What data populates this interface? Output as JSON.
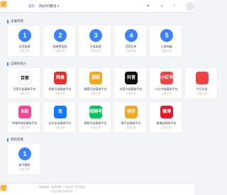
{
  "nav": {
    "logo": "鄉",
    "home": "首页",
    "map": "网站导航",
    "more": "更多 ▾",
    "icons": [
      "lightbulb-icon",
      "search-icon",
      "moon-icon"
    ]
  },
  "sections": {
    "main": {
      "title": "主编项目",
      "cards": [
        {
          "icon": "1",
          "color": "#3b82f6",
          "name": "抖音极速",
          "sub": "注册立享"
        },
        {
          "icon": "2",
          "color": "#3b82f6",
          "name": "网络赞奖励",
          "sub": "注册立享"
        },
        {
          "icon": "3",
          "color": "#3b82f6",
          "name": "头条极速",
          "sub": "注册立享"
        },
        {
          "icon": "4",
          "color": "#3b82f6",
          "name": "百家文库",
          "sub": "注册立享"
        },
        {
          "icon": "5",
          "color": "#3b82f6",
          "name": "小游戏赚",
          "sub": "注册立享"
        }
      ]
    },
    "media": {
      "title": "自媒体收入",
      "cards": [
        {
          "icon": "百家",
          "color": "#ffffff",
          "fg": "#111111",
          "name": "百家号自媒体平台",
          "sub": "注册立享"
        },
        {
          "icon": "网易",
          "color": "#e0322e",
          "fg": "#ffffff",
          "name": "网易号自媒体平台",
          "sub": "注册立享"
        },
        {
          "icon": "搜狐",
          "color": "#f5a623",
          "fg": "#ffffff",
          "name": "搜狐号自媒体平台",
          "sub": "注册立享"
        },
        {
          "icon": "抖音",
          "color": "#111111",
          "fg": "#ffffff",
          "name": "抖音号自媒体平台",
          "sub": "注册立享"
        },
        {
          "icon": "小红书",
          "color": "#ef4444",
          "fg": "#ffffff",
          "name": "小红书自媒体平台",
          "sub": "注册立享"
        },
        {
          "icon": "",
          "color": "#ef4444",
          "fg": "#ffffff",
          "name": "今日头条",
          "sub": "注册立享"
        }
      ]
    },
    "media2": {
      "cards": [
        {
          "icon": "B站",
          "color": "#ec4899",
          "fg": "#ffffff",
          "name": "哔哩哔哩自媒体平台",
          "sub": "注册立享"
        },
        {
          "icon": "支",
          "color": "#1677ff",
          "fg": "#ffffff",
          "name": "支付宝自媒体平台",
          "sub": "注册立享"
        },
        {
          "icon": "视频号",
          "color": "#07c160",
          "fg": "#ffffff",
          "name": "视频号自媒体平台",
          "sub": "注册立享"
        },
        {
          "icon": "快手",
          "color": "#f5a623",
          "fg": "#ffffff",
          "name": "快手自媒体平台",
          "sub": "注册立享"
        },
        {
          "icon": "微博",
          "color": "#e6162d",
          "fg": "#ffffff",
          "name": "微博自媒体平台",
          "sub": "注册立享"
        }
      ]
    },
    "tutorial": {
      "title": "教程指南",
      "cards": [
        {
          "icon": "1",
          "color": "#3b82f6",
          "name": "新手教程",
          "sub": "注册立享"
        }
      ]
    }
  },
  "footer": {
    "logo": "鄉",
    "links": "网站声明 · 免责声明 · 广告合作 · 关于我们",
    "copy": "© 网站导航 版权所有"
  }
}
